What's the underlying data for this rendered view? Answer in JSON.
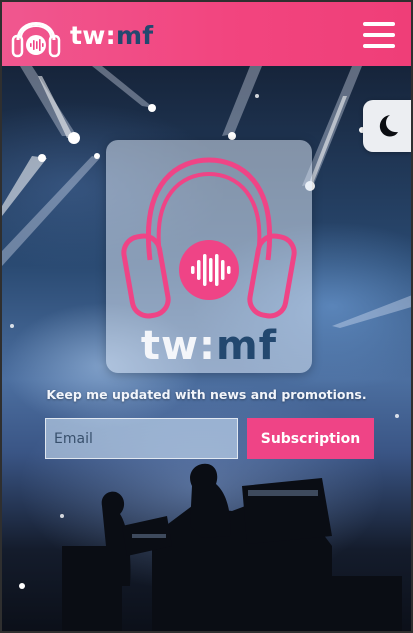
{
  "brand": {
    "name_part1": "tw:",
    "name_part2": "mf",
    "logo_icon": "headphones-icon"
  },
  "header": {
    "menu_icon": "hamburger-menu-icon"
  },
  "theme_toggle": {
    "icon": "moon-icon"
  },
  "hero": {
    "logo_word_part1": "tw:",
    "logo_word_part2": "mf"
  },
  "newsletter": {
    "text": "Keep me updated with news and promotions.",
    "email_placeholder": "Email",
    "button_label": "Subscription"
  },
  "colors": {
    "brand_pink": "#ef4486",
    "brand_navy": "#23486f",
    "header_gradient_start": "#f0578f",
    "header_gradient_end": "#ef3e78"
  }
}
